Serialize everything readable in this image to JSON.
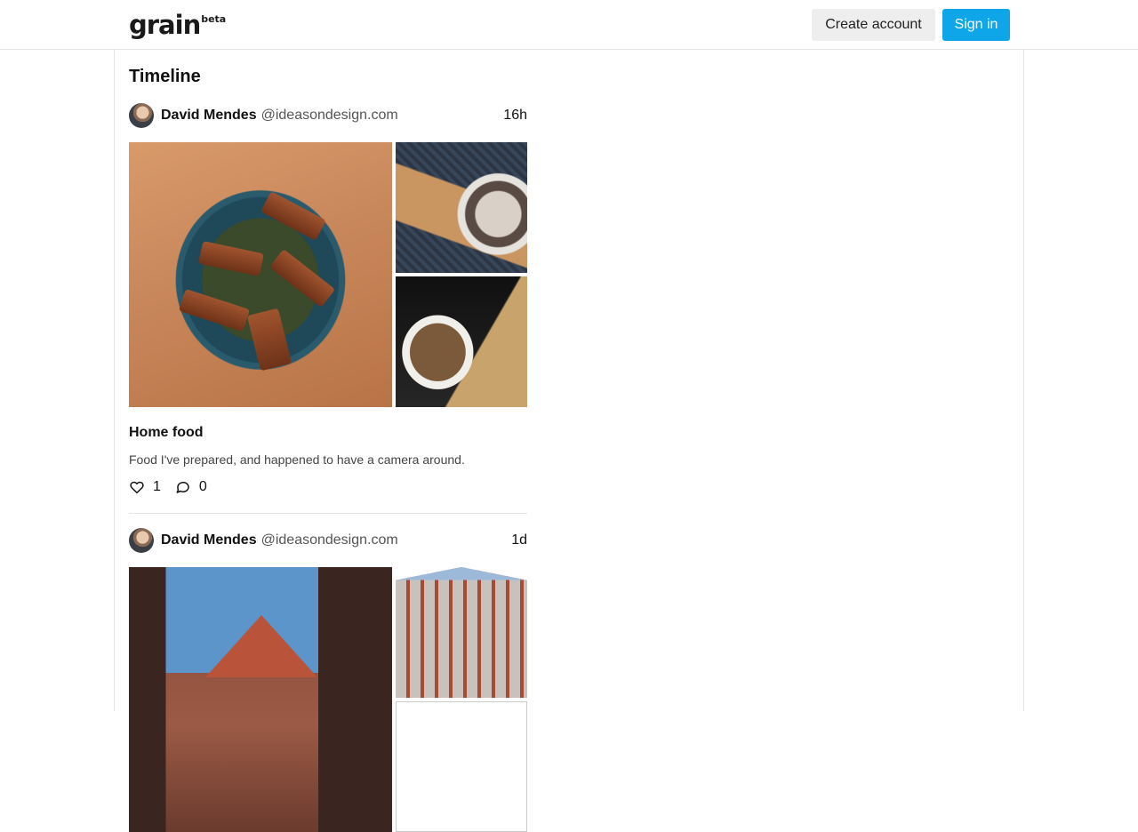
{
  "header": {
    "brand": "grain",
    "brand_badge": "beta",
    "create_account_label": "Create account",
    "sign_in_label": "Sign in",
    "accent_color": "#0ea5e9"
  },
  "page": {
    "title": "Timeline"
  },
  "posts": [
    {
      "author_name": "David Mendes",
      "author_handle": "@ideasondesign.com",
      "time": "16h",
      "title": "Home food",
      "description": "Food I've prepared, and happened to have a camera around.",
      "likes": "1",
      "comments": "0",
      "icons": [
        "heart-icon",
        "comment-icon"
      ]
    },
    {
      "author_name": "David Mendes",
      "author_handle": "@ideasondesign.com",
      "time": "1d"
    }
  ]
}
